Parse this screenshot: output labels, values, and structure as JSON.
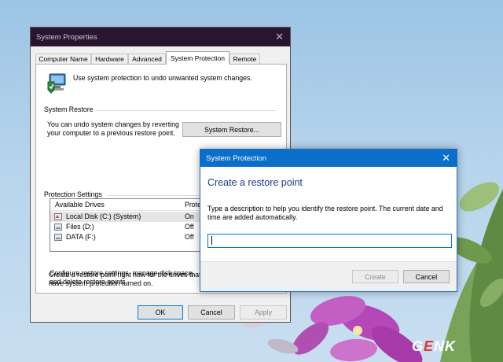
{
  "system_properties": {
    "title": "System Properties",
    "tabs": [
      "Computer Name",
      "Hardware",
      "Advanced",
      "System Protection",
      "Remote"
    ],
    "active_tab": "System Protection",
    "intro": "Use system protection to undo unwanted system changes.",
    "system_restore": {
      "group_label": "System Restore",
      "description_line1": "You can undo system changes by reverting",
      "description_line2": "your computer to a previous restore point.",
      "button_label": "System Restore..."
    },
    "protection_settings": {
      "group_label": "Protection Settings",
      "columns": [
        "Available Drives",
        "Prote"
      ],
      "drives": [
        {
          "name": "Local Disk (C:) (System)",
          "protection": "On"
        },
        {
          "name": "Files (D:)",
          "protection": "Off"
        },
        {
          "name": "DATA (F:)",
          "protection": "Off"
        }
      ],
      "configure_line1": "Configure restore settings, manage disk space,",
      "configure_line2": "and delete restore points.",
      "create_line1": "Create a restore point right now for the drives that",
      "create_line2": "have system protection turned on."
    },
    "buttons": {
      "ok": "OK",
      "cancel": "Cancel",
      "apply": "Apply"
    }
  },
  "system_protection_dialog": {
    "title": "System Protection",
    "heading": "Create a restore point",
    "description_line1": "Type a description to help you identify the restore point. The current date and",
    "description_line2": "time are added automatically.",
    "input_value": "",
    "buttons": {
      "create": "Create",
      "cancel": "Cancel"
    }
  },
  "watermark": {
    "part1": "G",
    "part2": "E",
    "part3": "NK"
  },
  "colors": {
    "sysprops_titlebar": "#2a1530",
    "dialog_titlebar": "#0b6ec8",
    "heading": "#1d3a8a",
    "flower": "#b548b8"
  },
  "icons": [
    "close-icon",
    "system-protection-icon",
    "drive-icon"
  ]
}
